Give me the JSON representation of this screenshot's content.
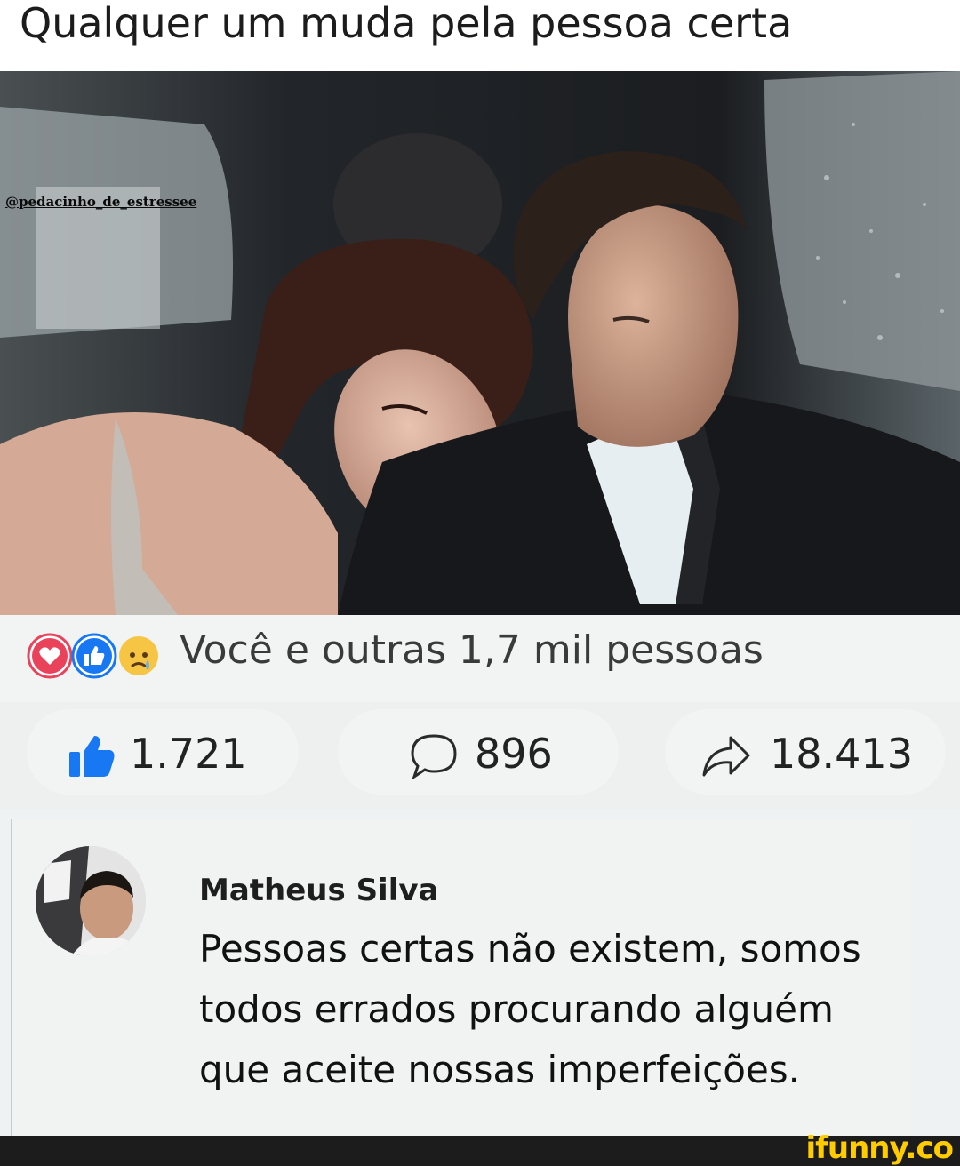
{
  "post": {
    "caption": "Qualquer um muda pela pessoa certa",
    "image_watermark": "@pedacinho_de_estressee"
  },
  "reactions": {
    "icons": [
      "love-icon",
      "like-icon",
      "sad-icon"
    ],
    "summary": "Você e outras 1,7 mil pessoas"
  },
  "stats": {
    "likes": "1.721",
    "comments": "896",
    "shares": "18.413"
  },
  "comment": {
    "author": "Matheus Silva",
    "text": "Pessoas certas não existem, somos todos errados procurando alguém que aceite nossas imperfeições."
  },
  "footer": {
    "brand": "ifunny.co"
  },
  "colors": {
    "like_blue": "#1877f2",
    "love_red": "#e9435c",
    "brand_yellow": "#ffcc00"
  }
}
